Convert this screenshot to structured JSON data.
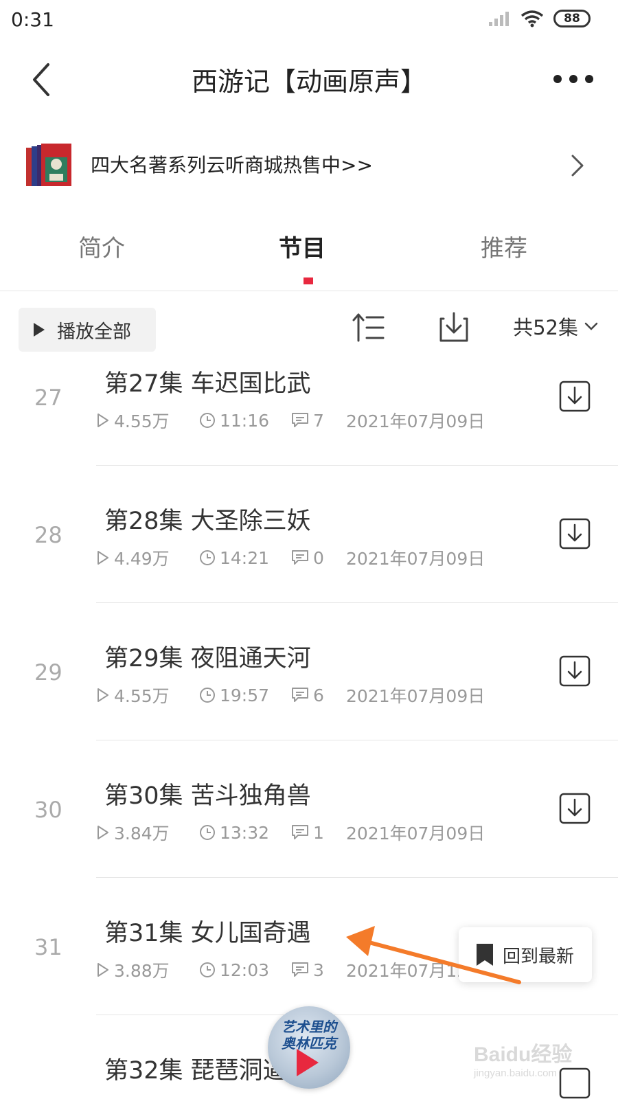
{
  "status_bar": {
    "time": "0:31",
    "battery": "88"
  },
  "header": {
    "title": "西游记【动画原声】"
  },
  "promo": {
    "text": "四大名著系列云听商城热售中>>"
  },
  "tabs": [
    {
      "label": "简介"
    },
    {
      "label": "节目"
    },
    {
      "label": "推荐"
    }
  ],
  "toolbar": {
    "play_all_label": "播放全部",
    "episode_count": "共52集"
  },
  "episodes": [
    {
      "num": "27",
      "title": "第27集 车迟国比武",
      "plays": "4.55万",
      "duration": "11:16",
      "comments": "7",
      "date": "2021年07月09日"
    },
    {
      "num": "28",
      "title": "第28集 大圣除三妖",
      "plays": "4.49万",
      "duration": "14:21",
      "comments": "0",
      "date": "2021年07月09日"
    },
    {
      "num": "29",
      "title": "第29集 夜阻通天河",
      "plays": "4.55万",
      "duration": "19:57",
      "comments": "6",
      "date": "2021年07月09日"
    },
    {
      "num": "30",
      "title": "第30集 苦斗独角兽",
      "plays": "3.84万",
      "duration": "13:32",
      "comments": "1",
      "date": "2021年07月09日"
    },
    {
      "num": "31",
      "title": "第31集 女儿国奇遇",
      "plays": "3.88万",
      "duration": "12:03",
      "comments": "3",
      "date": "2021年07月12日"
    },
    {
      "num": "32",
      "title": "第32集 琵琶洞逼婚"
    }
  ],
  "back_to_latest": {
    "label": "回到最新"
  },
  "mini_player": {
    "cover_text": "艺术里的奥林匹克"
  },
  "watermark": {
    "logo": "Baidu经验",
    "url": "jingyan.baidu.com"
  },
  "colors": {
    "accent": "#e8283f",
    "annotation": "#f47b2a"
  }
}
